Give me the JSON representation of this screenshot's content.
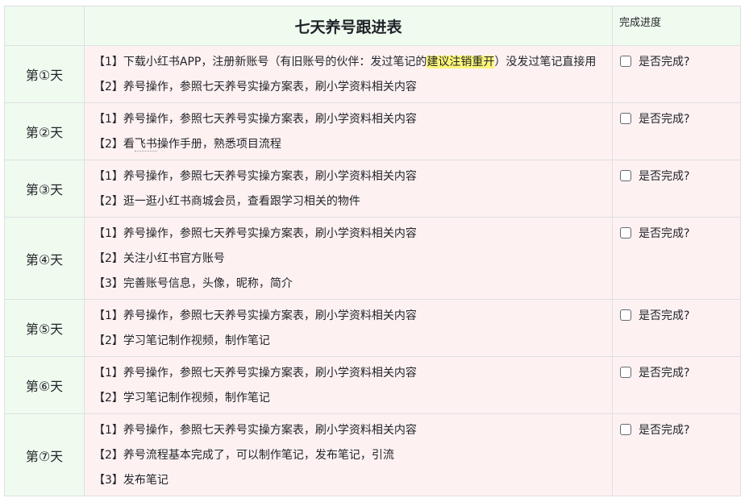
{
  "table": {
    "title": "七天养号跟进表",
    "progress_header": "完成进度",
    "rows": [
      {
        "day": "第①天",
        "items": [
          {
            "before": "【1】下载小红书APP，注册新账号（有旧账号的伙伴：发过笔记的",
            "highlight": "建议注销重开",
            "after": "）没发过笔记直接用"
          },
          {
            "text": "【2】养号操作，参照七天养号实操方案表，刷小学资料相关内容"
          }
        ],
        "check_label": "是否完成?",
        "checked": false
      },
      {
        "day": "第②天",
        "items": [
          {
            "text": "【1】养号操作，参照七天养号实操方案表，刷小学资料相关内容"
          },
          {
            "before": "【2】看",
            "link": "飞书",
            "after": "操作手册，熟悉项目流程"
          }
        ],
        "check_label": "是否完成?",
        "checked": false
      },
      {
        "day": "第③天",
        "items": [
          {
            "text": "【1】养号操作，参照七天养号实操方案表，刷小学资料相关内容"
          },
          {
            "text": "【2】逛一逛小红书商城会员，查看跟学习相关的物件"
          }
        ],
        "check_label": "是否完成?",
        "checked": false
      },
      {
        "day": "第④天",
        "items": [
          {
            "text": "【1】养号操作，参照七天养号实操方案表，刷小学资料相关内容"
          },
          {
            "text": "【2】关注小红书官方账号"
          },
          {
            "text": "【3】完善账号信息，头像，昵称，简介"
          }
        ],
        "check_label": "是否完成?",
        "checked": false
      },
      {
        "day": "第⑤天",
        "items": [
          {
            "text": "【1】养号操作，参照七天养号实操方案表，刷小学资料相关内容"
          },
          {
            "text": "【2】学习笔记制作视频，制作笔记"
          }
        ],
        "check_label": "是否完成?",
        "checked": false
      },
      {
        "day": "第⑥天",
        "items": [
          {
            "text": "【1】养号操作，参照七天养号实操方案表，刷小学资料相关内容"
          },
          {
            "text": "【2】学习笔记制作视频，制作笔记"
          }
        ],
        "check_label": "是否完成?",
        "checked": false
      },
      {
        "day": "第⑦天",
        "items": [
          {
            "text": "【1】养号操作，参照七天养号实操方案表，刷小学资料相关内容"
          },
          {
            "text": "【2】养号流程基本完成了，可以制作笔记，发布笔记，引流"
          },
          {
            "text": "【3】发布笔记"
          }
        ],
        "check_label": "是否完成?",
        "checked": false
      }
    ]
  },
  "colors": {
    "header_bg": "#f0fbef",
    "day_bg": "#f0fbef",
    "body_bg": "#fef1f1",
    "highlight": "#fff67a",
    "border": "#dee0e3",
    "text": "#1f2329"
  }
}
